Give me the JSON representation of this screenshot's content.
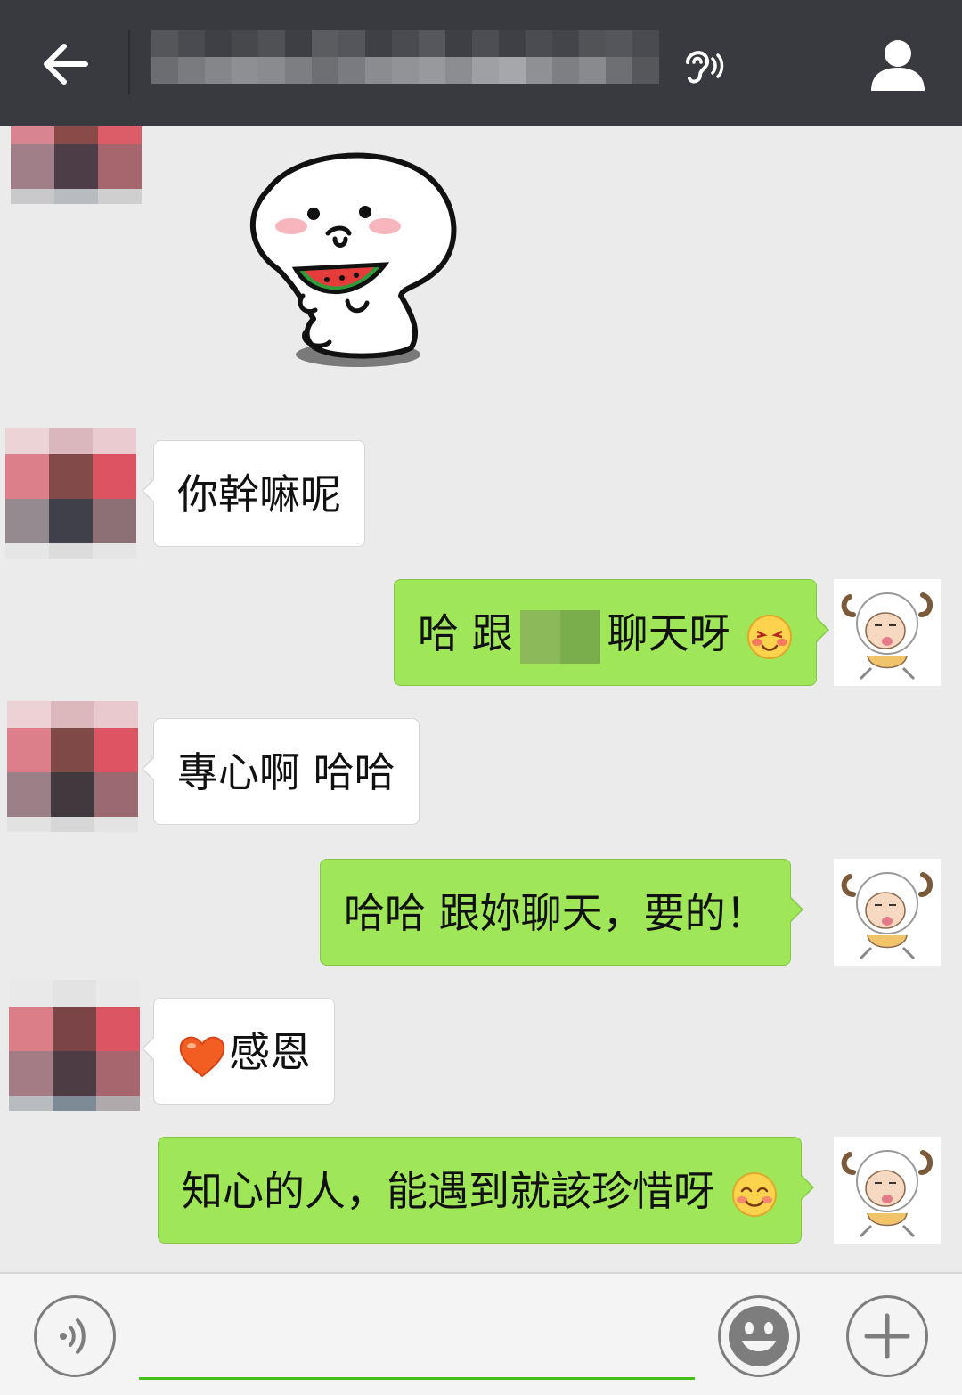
{
  "header": {
    "back_icon": "arrow-left-icon",
    "title": "",
    "earpiece_icon": "earpiece-mode-icon",
    "profile_icon": "person-icon"
  },
  "messages": [
    {
      "side": "left",
      "type": "sticker",
      "sticker": "white-blob-eating-watermelon"
    },
    {
      "side": "left",
      "type": "text",
      "text": "你幹嘛呢"
    },
    {
      "side": "right",
      "type": "text",
      "text_before": "哈  跟",
      "text_after": "聊天呀",
      "emoji": "blushing-face-icon"
    },
    {
      "side": "left",
      "type": "text",
      "text": "專心啊  哈哈"
    },
    {
      "side": "right",
      "type": "text",
      "text": "哈哈  跟妳聊天，要的！"
    },
    {
      "side": "left",
      "type": "text",
      "text": "感恩",
      "emoji": "heart-icon"
    },
    {
      "side": "right",
      "type": "text",
      "text": "知心的人，能遇到就該珍惜呀",
      "emoji": "smiling-face-icon"
    }
  ],
  "input_bar": {
    "voice_icon": "voice-input-icon",
    "emoji_icon": "emoji-icon",
    "plus_icon": "plus-icon",
    "accent_color": "#45c01a"
  },
  "colors": {
    "topbar": "#393a3f",
    "chat_bg": "#ebebeb",
    "sent_bubble": "#9fe658",
    "received_bubble": "#ffffff"
  }
}
